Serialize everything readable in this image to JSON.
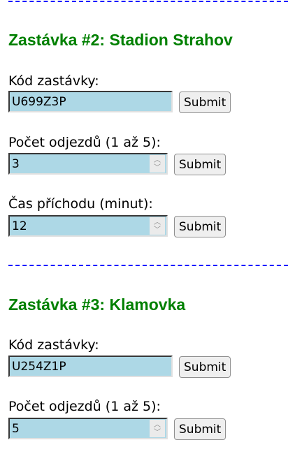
{
  "stops": [
    {
      "title": "Zastávka #2: Stadion Strahov",
      "code_label": "Kód zastávky:",
      "code_value": "U699Z3P",
      "departures_label": "Počet odjezdů (1 až 5):",
      "departures_value": "3",
      "arrival_label": "Čas příchodu (minut):",
      "arrival_value": "12"
    },
    {
      "title": "Zastávka #3: Klamovka",
      "code_label": "Kód zastávky:",
      "code_value": "U254Z1P",
      "departures_label": "Počet odjezdů (1 až 5):",
      "departures_value": "5"
    }
  ],
  "submit_label": "Submit",
  "colors": {
    "heading": "#008000",
    "input_bg": "#add8e6",
    "separator": "#1a1aff"
  }
}
